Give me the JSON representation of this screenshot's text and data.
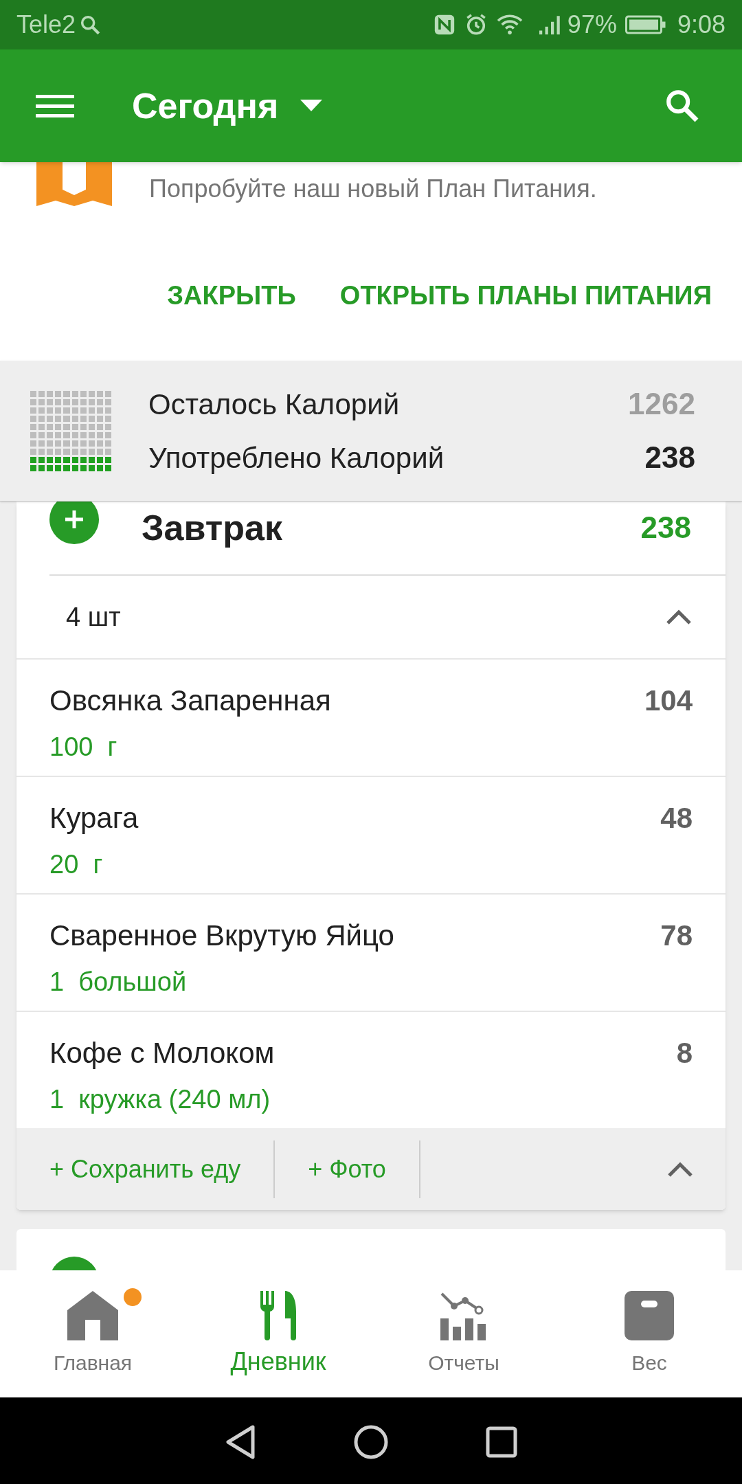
{
  "status_bar": {
    "carrier": "Tele2",
    "battery": "97%",
    "time": "9:08"
  },
  "app_bar": {
    "title": "Сегодня"
  },
  "banner": {
    "text": "Попробуйте наш новый План Питания.",
    "buttons": [
      "ЗАКРЫТЬ",
      "ОТКРЫТЬ ПЛАНЫ ПИТАНИЯ"
    ]
  },
  "summary": {
    "rows": [
      {
        "label": "Осталось Калорий",
        "value": "1262",
        "kind": "remaining"
      },
      {
        "label": "Употреблено Калорий",
        "value": "238",
        "kind": "consumed"
      }
    ]
  },
  "meal": {
    "title": "Завтрак",
    "calories": "238",
    "count": "4 шт",
    "expanded": true,
    "items": [
      {
        "name": "Овсянка Запаренная",
        "amount": "100  г",
        "calories": "104"
      },
      {
        "name": "Курага",
        "amount": "20  г",
        "calories": "48"
      },
      {
        "name": "Сваренное Вкрутую Яйцо",
        "amount": "1  большой",
        "calories": "78"
      },
      {
        "name": "Кофе с Молоком",
        "amount": "1  кружка (240 мл)",
        "calories": "8"
      }
    ],
    "actions": [
      "+ Сохранить еду",
      "+ Фото"
    ]
  },
  "bottom_nav": [
    {
      "label": "Главная",
      "kind": "home",
      "selected": false,
      "badge": true
    },
    {
      "label": "Дневник",
      "kind": "diary",
      "selected": true,
      "badge": false
    },
    {
      "label": "Отчеты",
      "kind": "reports",
      "selected": false,
      "badge": false
    },
    {
      "label": "Вес",
      "kind": "weight",
      "selected": false,
      "badge": false
    }
  ]
}
